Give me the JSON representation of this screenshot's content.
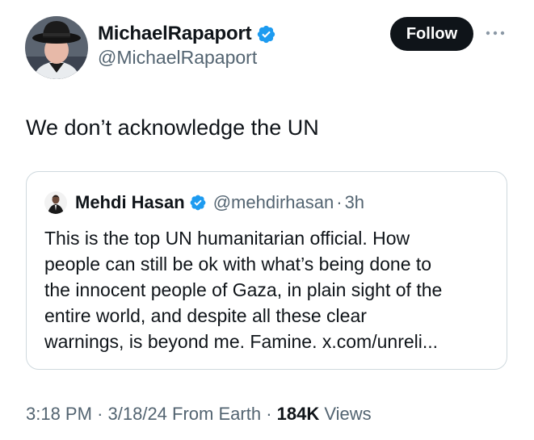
{
  "tweet": {
    "author": {
      "display_name": "MichaelRapaport",
      "handle": "@MichaelRapaport",
      "verified": true
    },
    "follow_label": "Follow",
    "more_icon": "more-dots-icon",
    "text": "We don’t acknowledge the UN",
    "quoted": {
      "author_name": "Mehdi Hasan",
      "verified": true,
      "handle": "@mehdirhasan",
      "separator": "·",
      "time": "3h",
      "lines": [
        "This is the top UN humanitarian official. How",
        "people can still be ok with what’s being done to",
        "the innocent people of Gaza, in plain sight of the",
        "entire world, and despite all these clear",
        "warnings, is beyond me. Famine. x.com/unreli..."
      ]
    },
    "meta": {
      "time": "3:18 PM",
      "sep1": "·",
      "date": "3/18/24",
      "source": "From Earth",
      "sep2": "·",
      "views_count": "184K",
      "views_label": "Views"
    }
  },
  "colors": {
    "verified_blue": "#1d9bf0",
    "text_primary": "#0f1419",
    "text_secondary": "#536471",
    "border": "#cfd9de"
  }
}
